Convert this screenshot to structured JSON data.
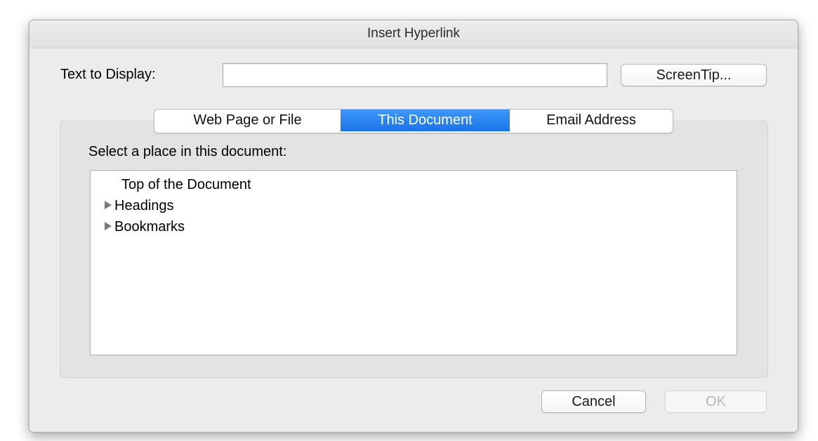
{
  "dialog": {
    "title": "Insert Hyperlink"
  },
  "text_to_display": {
    "label": "Text to Display:",
    "value": "",
    "placeholder": ""
  },
  "screentip_button": {
    "label": "ScreenTip..."
  },
  "tabs": [
    {
      "label": "Web Page or File",
      "active": false
    },
    {
      "label": "This Document",
      "active": true
    },
    {
      "label": "Email Address",
      "active": false
    }
  ],
  "place_selector": {
    "label": "Select a place in this document:",
    "items": [
      {
        "label": "Top of the Document",
        "expandable": false
      },
      {
        "label": "Headings",
        "expandable": true,
        "icon": "disclosure-triangle-right"
      },
      {
        "label": "Bookmarks",
        "expandable": true,
        "icon": "disclosure-triangle-right"
      }
    ]
  },
  "footer": {
    "cancel_label": "Cancel",
    "ok_label": "OK",
    "ok_enabled": false
  },
  "colors": {
    "accent": "#1a73e8",
    "dialog_bg": "#ececec",
    "panel_bg": "#e3e3e3"
  }
}
